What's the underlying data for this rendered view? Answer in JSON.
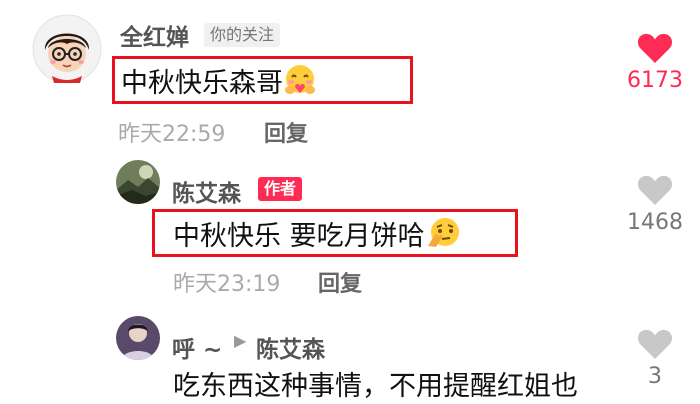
{
  "comment1": {
    "username": "全红婵",
    "tag": "你的关注",
    "text": "中秋快乐森哥",
    "emoji": "hug-face",
    "time": "昨天22:59",
    "reply_label": "回复",
    "likes": "6173",
    "liked": true,
    "like_color": "#fe2c55"
  },
  "comment2": {
    "username": "陈艾森",
    "tag": "作者",
    "text": "中秋快乐 要吃月饼哈",
    "emoji": "thinking-face",
    "time": "昨天23:19",
    "reply_label": "回复",
    "likes": "1468",
    "liked": false
  },
  "comment3": {
    "username": "呼 ~",
    "reply_arrow": "▶",
    "reply_to": "陈艾森",
    "text": "吃东西这种事情，不用提醒红姐也",
    "likes": "3",
    "liked": false
  },
  "colors": {
    "accent": "#fe2c55",
    "highlight_border": "#e8121e",
    "heart_gray": "#c8c8c8"
  }
}
